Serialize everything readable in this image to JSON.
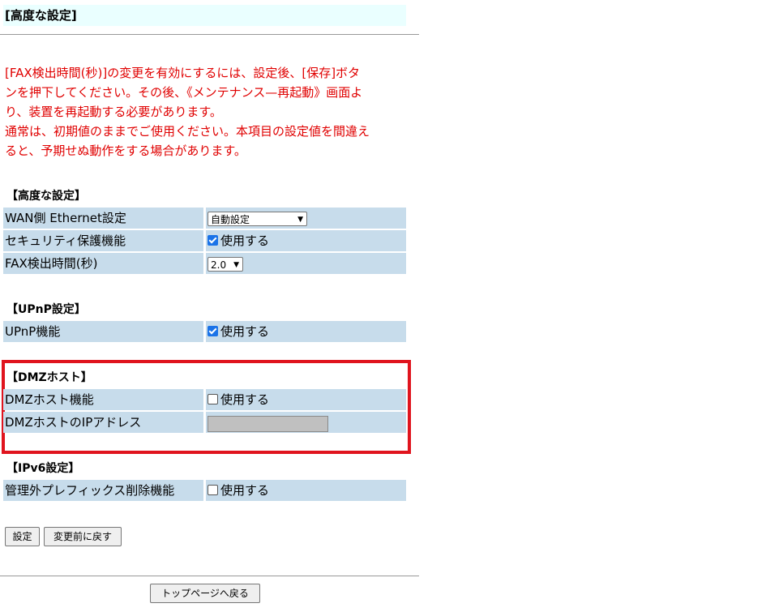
{
  "title": "[高度な設定]",
  "notice": {
    "line1": "[FAX検出時間(秒)]の変更を有効にするには、設定後、[保存]ボタ",
    "line2": "ンを押下してください。その後、《メンテナンス—再起動》画面よ",
    "line3": "り、装置を再起動する必要があります。",
    "line4": "通常は、初期値のままでご使用ください。本項目の設定値を間違え",
    "line5": "ると、予期せぬ動作をする場合があります。"
  },
  "sections": {
    "advanced": {
      "heading": "【高度な設定】",
      "wan_label": "WAN側 Ethernet設定",
      "wan_value": "自動設定",
      "security_label": "セキュリティ保護機能",
      "security_value": "使用する",
      "security_checked": true,
      "fax_label": "FAX検出時間(秒)",
      "fax_value": "2.0"
    },
    "upnp": {
      "heading": "【UPnP設定】",
      "label": "UPnP機能",
      "value": "使用する",
      "checked": true
    },
    "dmz": {
      "heading": "【DMZホスト】",
      "func_label": "DMZホスト機能",
      "func_value": "使用する",
      "func_checked": false,
      "ip_label": "DMZホストのIPアドレス",
      "ip_value": ""
    },
    "ipv6": {
      "heading": "【IPv6設定】",
      "label": "管理外プレフィックス削除機能",
      "value": "使用する",
      "checked": false
    }
  },
  "buttons": {
    "apply": "設定",
    "revert": "変更前に戻す",
    "top": "トップページへ戻る"
  },
  "colors": {
    "highlight": "#e0141e",
    "notice": "#e00000",
    "row_bg": "#c7dceb",
    "title_bg": "#eaffff"
  }
}
